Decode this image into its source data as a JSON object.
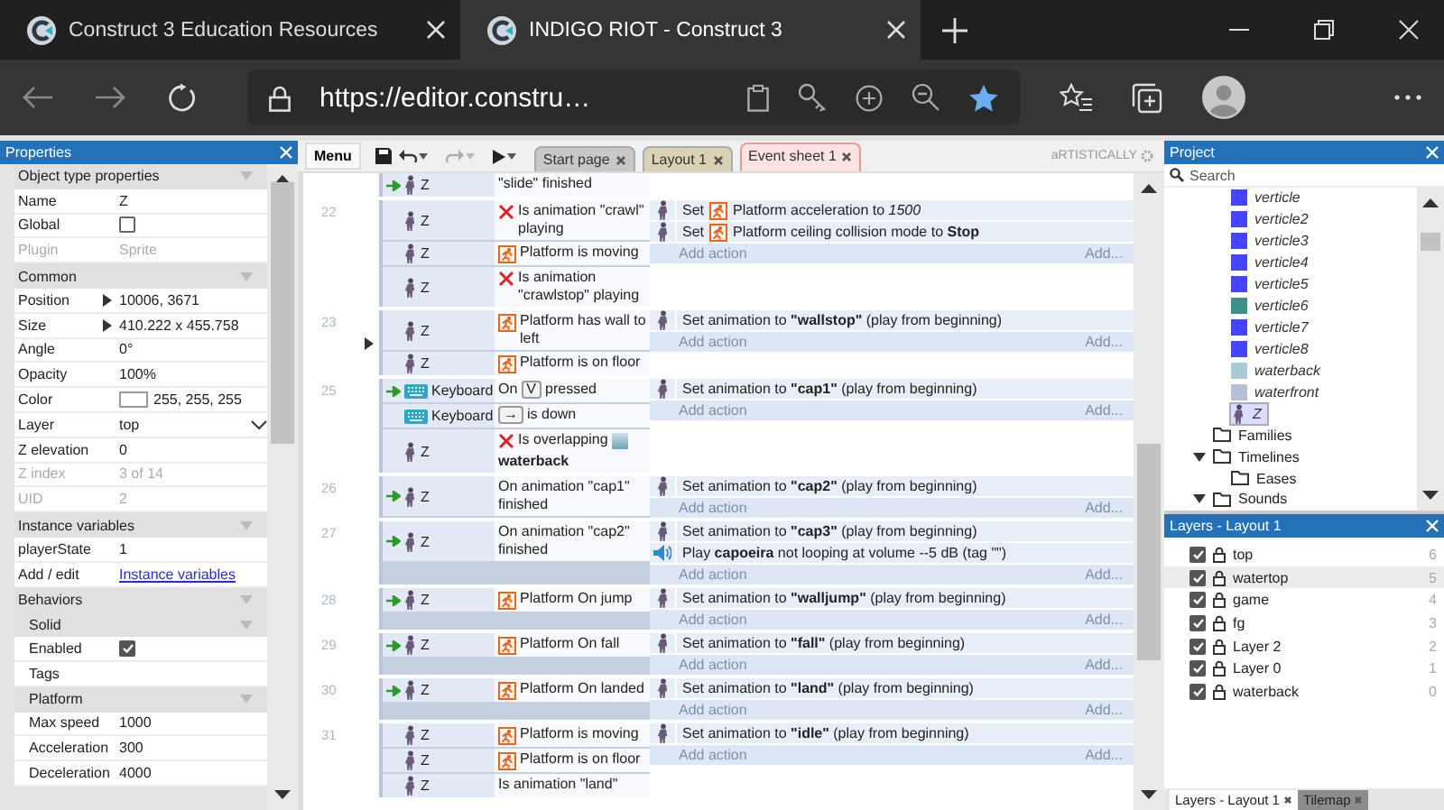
{
  "browser": {
    "tabs": [
      {
        "title": "Construct 3 Education Resources",
        "selected": false
      },
      {
        "title": "INDIGO RIOT - Construct 3",
        "selected": true
      }
    ],
    "url": "https://editor.constru…"
  },
  "properties": {
    "title": "Properties",
    "sections": [
      {
        "title": "Object type properties",
        "rows": [
          {
            "kind": "text",
            "label": "Name",
            "value": "Z",
            "disabled": false
          },
          {
            "kind": "checkbox",
            "label": "Global",
            "checked": false,
            "disabled": false
          },
          {
            "kind": "text",
            "label": "Plugin",
            "value": "Sprite",
            "disabled": true
          }
        ]
      },
      {
        "title": "Common",
        "rows": [
          {
            "kind": "expand",
            "label": "Position",
            "value": "10006, 3671",
            "disabled": false
          },
          {
            "kind": "expand",
            "label": "Size",
            "value": "410.222 x 455.758",
            "disabled": false
          },
          {
            "kind": "text",
            "label": "Angle",
            "value": "0°",
            "disabled": false
          },
          {
            "kind": "text",
            "label": "Opacity",
            "value": "100%",
            "disabled": false
          },
          {
            "kind": "color",
            "label": "Color",
            "color": "#ffffff",
            "value": "255, 255, 255",
            "disabled": false
          },
          {
            "kind": "dropdown",
            "label": "Layer",
            "value": "top",
            "disabled": false
          },
          {
            "kind": "text",
            "label": "Z elevation",
            "value": "0",
            "disabled": false
          },
          {
            "kind": "text",
            "label": "Z index",
            "value": "3 of 14",
            "disabled": true
          },
          {
            "kind": "text",
            "label": "UID",
            "value": "2",
            "disabled": true
          }
        ]
      },
      {
        "title": "Instance variables",
        "rows": [
          {
            "kind": "text",
            "label": "playerState",
            "value": "1",
            "disabled": false
          },
          {
            "kind": "link",
            "label": "Add / edit",
            "value": "Instance variables",
            "disabled": false
          }
        ]
      },
      {
        "title": "Behaviors",
        "groups": [
          {
            "title": "Solid",
            "rows": [
              {
                "kind": "checkbox",
                "label": "Enabled",
                "checked": true,
                "disabled": false
              },
              {
                "kind": "text",
                "label": "Tags",
                "disabled": false
              }
            ]
          },
          {
            "title": "Platform",
            "rows": [
              {
                "kind": "text",
                "label": "Max speed",
                "value": "1000",
                "disabled": false
              },
              {
                "kind": "text",
                "label": "Acceleration",
                "value": "300",
                "disabled": false
              },
              {
                "kind": "text",
                "label": "Deceleration",
                "value": "4000",
                "disabled": false
              }
            ]
          }
        ]
      }
    ]
  },
  "editor": {
    "toolbar": {
      "menu": "Menu",
      "undo_disabled": false,
      "redo_disabled": true
    },
    "tabs": [
      {
        "label": "Start page",
        "color": "#c8c8c8",
        "selected": false
      },
      {
        "label": "Layout 1",
        "color": "#d9d2b4",
        "selected": false
      },
      {
        "label": "Event sheet 1",
        "color": "#fde2e2",
        "selected": true
      }
    ],
    "theme_label": "aRTISTICALLY",
    "events": [
      {
        "conditions": [
          {
            "kind": "plain",
            "trigger": true,
            "object": "Z",
            "text": "\"slide\" finished"
          }
        ]
      },
      {
        "number": "22",
        "conditions": [
          {
            "kind": "inverted",
            "trigger": false,
            "object": "Z",
            "text": "Is animation \"crawl\" playing"
          },
          {
            "kind": "behavior",
            "trigger": false,
            "object": "Z",
            "text": "Platform is moving"
          },
          {
            "kind": "inverted",
            "trigger": false,
            "object": "Z",
            "text": "Is animation \"crawlstop\" playing"
          }
        ],
        "actions": [
          {
            "kind": "set-behavior",
            "prefix": "Set",
            "text": "Platform acceleration to *1500*"
          },
          {
            "kind": "set-behavior",
            "prefix": "Set",
            "text": "Platform ceiling collision mode to **Stop**"
          }
        ],
        "add_action": "Add action",
        "add_more": "Add..."
      },
      {
        "number": "23",
        "expanded": false,
        "conditions": [
          {
            "kind": "behavior",
            "trigger": false,
            "object": "Z",
            "text": "Platform has wall to left"
          },
          {
            "kind": "behavior",
            "trigger": false,
            "object": "Z",
            "text": "Platform is on floor"
          }
        ],
        "actions": [
          {
            "kind": "sprite",
            "text": "Set animation to **\"wallstop\"** (play from beginning)"
          }
        ],
        "add_action": "Add action",
        "add_more": "Add..."
      },
      {
        "number": "25",
        "conditions": [
          {
            "kind": "keyboard",
            "trigger": true,
            "object": "Keyboard",
            "prefix": "On",
            "key": "V",
            "text": "pressed"
          },
          {
            "kind": "keyboard",
            "trigger": false,
            "object": "Keyboard",
            "key": "→",
            "text": "is down"
          },
          {
            "kind": "inverted",
            "trigger": false,
            "object": "Z",
            "text": "Is overlapping",
            "target": "waterback"
          }
        ],
        "actions": [
          {
            "kind": "sprite",
            "text": "Set animation to **\"cap1\"** (play from beginning)"
          }
        ],
        "add_action": "Add action",
        "add_more": "Add..."
      },
      {
        "number": "26",
        "conditions": [
          {
            "kind": "plain",
            "trigger": true,
            "object": "Z",
            "text": "On animation \"cap1\" finished"
          }
        ],
        "actions": [
          {
            "kind": "sprite",
            "text": "Set animation to **\"cap2\"** (play from beginning)"
          }
        ],
        "add_action": "Add action",
        "add_more": "Add..."
      },
      {
        "number": "27",
        "conditions": [
          {
            "kind": "plain",
            "trigger": true,
            "object": "Z",
            "text": "On animation \"cap2\" finished"
          }
        ],
        "actions": [
          {
            "kind": "sprite",
            "text": "Set animation to **\"cap3\"** (play from beginning)"
          },
          {
            "kind": "sound",
            "text": "Play **capoeira** not looping at volume --5 dB (tag \"\")"
          }
        ],
        "add_action": "Add action",
        "add_more": "Add..."
      },
      {
        "number": "28",
        "conditions": [
          {
            "kind": "behavior",
            "trigger": true,
            "object": "Z",
            "text": "Platform On jump"
          }
        ],
        "actions": [
          {
            "kind": "sprite",
            "text": "Set animation to **\"walljump\"** (play from beginning)"
          }
        ],
        "add_action": "Add action",
        "add_more": "Add..."
      },
      {
        "number": "29",
        "conditions": [
          {
            "kind": "behavior",
            "trigger": true,
            "object": "Z",
            "text": "Platform On fall"
          }
        ],
        "actions": [
          {
            "kind": "sprite",
            "text": "Set animation to **\"fall\"** (play from beginning)"
          }
        ],
        "add_action": "Add action",
        "add_more": "Add..."
      },
      {
        "number": "30",
        "conditions": [
          {
            "kind": "behavior",
            "trigger": true,
            "object": "Z",
            "text": "Platform On landed"
          }
        ],
        "actions": [
          {
            "kind": "sprite",
            "text": "Set animation to **\"land\"** (play from beginning)"
          }
        ],
        "add_action": "Add action",
        "add_more": "Add..."
      },
      {
        "number": "31",
        "conditions": [
          {
            "kind": "behavior",
            "trigger": false,
            "object": "Z",
            "text": "Platform is moving"
          },
          {
            "kind": "behavior",
            "trigger": false,
            "object": "Z",
            "text": "Platform is on floor"
          },
          {
            "kind": "plain",
            "trigger": false,
            "object": "Z",
            "text": "Is animation \"land\""
          }
        ],
        "actions": [
          {
            "kind": "sprite",
            "text": "Set animation to **\"idle\"** (play from beginning)"
          }
        ],
        "add_action": "Add action",
        "add_more": "Add..."
      }
    ]
  },
  "project": {
    "title": "Project",
    "search_placeholder": "Search",
    "object_types": [
      {
        "name": "verticle",
        "kind": "swatch",
        "color": "#4545ff",
        "selected": false
      },
      {
        "name": "verticle2",
        "kind": "swatch",
        "color": "#4545ff",
        "selected": false
      },
      {
        "name": "verticle3",
        "kind": "swatch",
        "color": "#4545ff",
        "selected": false
      },
      {
        "name": "verticle4",
        "kind": "swatch",
        "color": "#4545ff",
        "selected": false
      },
      {
        "name": "verticle5",
        "kind": "swatch",
        "color": "#4545ff",
        "selected": false
      },
      {
        "name": "verticle6",
        "kind": "swatch",
        "color": "#3f8f8a",
        "selected": false
      },
      {
        "name": "verticle7",
        "kind": "swatch",
        "color": "#4545ff",
        "selected": false
      },
      {
        "name": "verticle8",
        "kind": "swatch",
        "color": "#4545ff",
        "selected": false
      },
      {
        "name": "waterback",
        "kind": "swatch",
        "color": "#a9cbd6",
        "selected": false
      },
      {
        "name": "waterfront",
        "kind": "swatch",
        "color": "#b3bfd4",
        "selected": false
      },
      {
        "name": "Z",
        "kind": "sprite",
        "selected": true
      }
    ],
    "folders": [
      {
        "name": "Families",
        "selected": false
      },
      {
        "name": "Timelines",
        "expanded": true,
        "selected": false,
        "children": [
          {
            "name": "Eases",
            "selected": false
          }
        ]
      },
      {
        "name": "Sounds",
        "expanded": true,
        "selected": false
      }
    ]
  },
  "layers": {
    "title": "Layers - Layout 1",
    "items": [
      {
        "name": "top",
        "index": "6",
        "visible": true,
        "selected": false
      },
      {
        "name": "watertop",
        "index": "5",
        "visible": true,
        "selected": true
      },
      {
        "name": "game",
        "index": "4",
        "visible": true,
        "selected": false
      },
      {
        "name": "fg",
        "index": "3",
        "visible": true,
        "selected": false
      },
      {
        "name": "Layer 2",
        "index": "2",
        "visible": true,
        "selected": false
      },
      {
        "name": "Layer 0",
        "index": "1",
        "visible": true,
        "selected": false
      },
      {
        "name": "waterback",
        "index": "0",
        "visible": true,
        "selected": false
      }
    ],
    "tabs": [
      {
        "label": "Layers - Layout 1",
        "selected": true
      },
      {
        "label": "Tilemap",
        "selected": false
      }
    ]
  }
}
